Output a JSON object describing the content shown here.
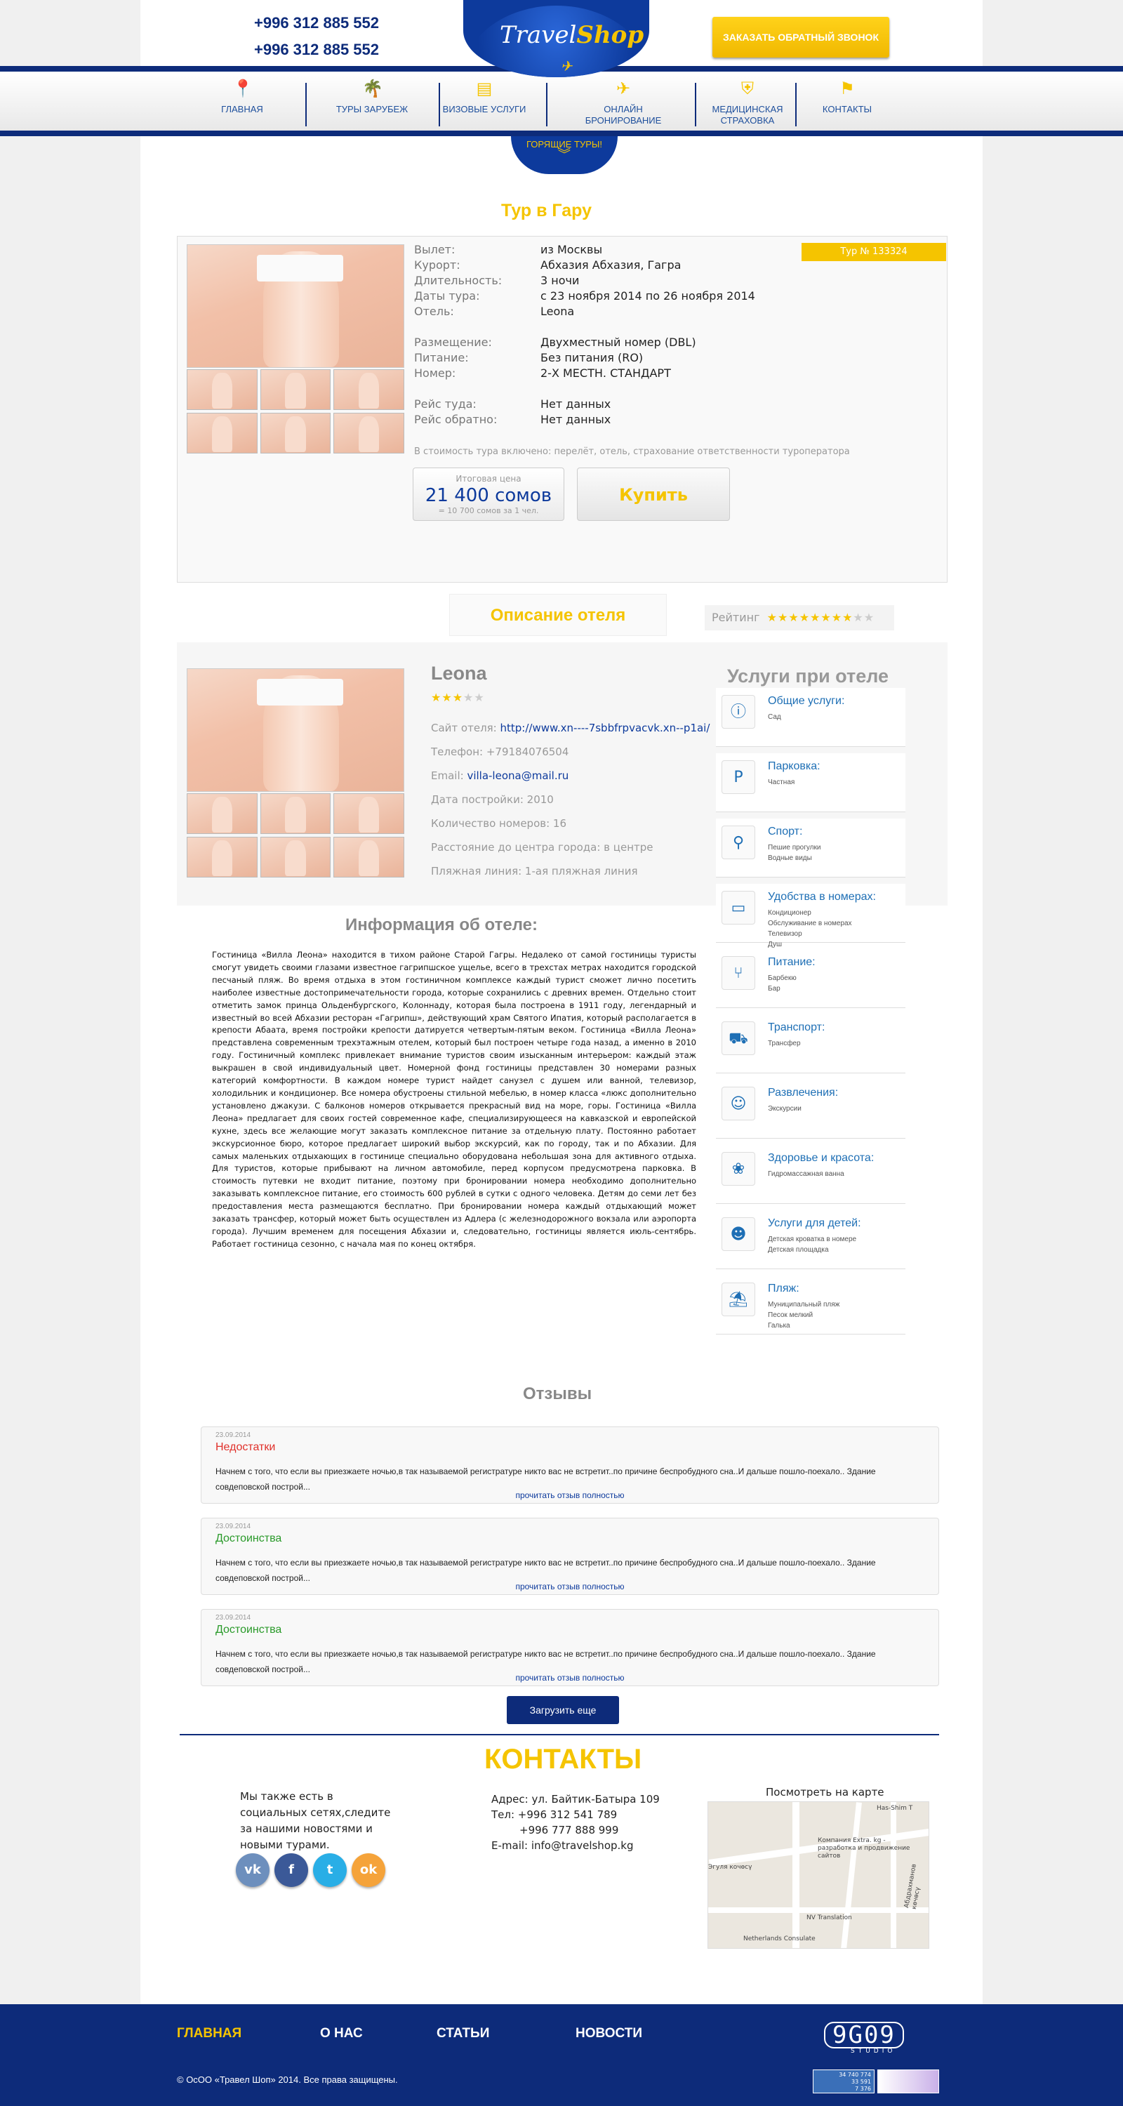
{
  "header": {
    "phone1": "+996 312 885 552",
    "phone2": "+996 312 885 552",
    "logo_travel": "Travel",
    "logo_shop": "Shop",
    "callback_label": "ЗАКАЗАТЬ ОБРАТНЫЙ ЗВОНОК",
    "hot_tours": "ГОРЯЩИЕ ТУРЫ!"
  },
  "nav": [
    {
      "label": "ГЛАВНАЯ",
      "icon": "location-pin-icon"
    },
    {
      "label": "ТУРЫ ЗАРУБЕЖ",
      "icon": "palm-tree-icon"
    },
    {
      "label": "ВИЗОВЫЕ УСЛУГИ",
      "icon": "passport-icon"
    },
    {
      "label": "ОНЛАЙН БРОНИРОВАНИЕ",
      "icon": "plane-icon"
    },
    {
      "label": "МЕДИЦИНСКАЯ СТРАХОВКА",
      "icon": "shield-icon"
    },
    {
      "label": "КОНТАКТЫ",
      "icon": "signpost-icon"
    }
  ],
  "tour": {
    "title": "Тур в Гару",
    "number": "Тур № 133324",
    "rows": [
      {
        "label": "Вылет:",
        "value": "из Москвы"
      },
      {
        "label": "Курорт:",
        "value": "Абхазия Абхазия, Гагра"
      },
      {
        "label": "Длительность:",
        "value": "3 ночи"
      },
      {
        "label": "Даты тура:",
        "value": "с 23 ноября 2014 по 26 ноября 2014"
      },
      {
        "label": "Отель:",
        "value": "Leona"
      },
      {
        "label": "Размещение:",
        "value": "Двухместный номер (DBL)"
      },
      {
        "label": "Питание:",
        "value": "Без питания (RO)"
      },
      {
        "label": "Номер:",
        "value": "2-Х МЕСТН. СТАНДАРТ"
      },
      {
        "label": "Рейс туда:",
        "value": "Нет данных"
      },
      {
        "label": "Рейс обратно:",
        "value": "Нет данных"
      }
    ],
    "included": "В стоимость тура включено: перелёт, отель, страхование ответственности туроператора",
    "price_label": "Итоговая цена",
    "price": "21 400 сомов",
    "price_per": "= 10 700 сомов за 1 чел.",
    "buy_label": "Купить"
  },
  "hotel": {
    "tab_label": "Описание отеля",
    "rating_label": "Рейтинг",
    "rating_value": 8,
    "rating_max": 10,
    "name": "Leona",
    "stars": 3,
    "site_label": "Сайт отеля:",
    "site": "http://www.xn----7sbbfrpvacvk.xn--p1ai/",
    "phone": "Телефон: +79184076504",
    "email_label": "Email:",
    "email": "villa-leona@mail.ru",
    "built": "Дата постройки: 2010",
    "rooms": "Количество номеров: 16",
    "distance": "Расстояние до центра города: в центре",
    "beach_line": "Пляжная линия: 1-ая пляжная линия"
  },
  "services": {
    "title": "Услуги при отеле",
    "items": [
      {
        "title": "Общие услуги:",
        "details": [
          "Сад"
        ],
        "icon": "info-icon"
      },
      {
        "title": "Парковка:",
        "details": [
          "Частная"
        ],
        "icon": "parking-icon"
      },
      {
        "title": "Спорт:",
        "details": [
          "Пешие прогулки",
          "Водные виды"
        ],
        "icon": "bicycle-icon"
      },
      {
        "title": "Удобства в номерах:",
        "details": [
          "Кондиционер",
          "Обслуживание в номерах",
          "Телевизор",
          "Душ"
        ],
        "icon": "tv-icon"
      },
      {
        "title": "Питание:",
        "details": [
          "Барбекю",
          "Бар"
        ],
        "icon": "cutlery-icon"
      },
      {
        "title": "Транспорт:",
        "details": [
          "Трансфер"
        ],
        "icon": "car-icon"
      },
      {
        "title": "Развлечения:",
        "details": [
          "Экскурсии"
        ],
        "icon": "dancing-icon"
      },
      {
        "title": "Здоровье и красота:",
        "details": [
          "Гидромассажная ванна"
        ],
        "icon": "spa-icon"
      },
      {
        "title": "Услуги для детей:",
        "details": [
          "Детская кроватка в номере",
          "Детская площадка"
        ],
        "icon": "child-icon"
      },
      {
        "title": "Пляж:",
        "details": [
          "Муниципальный пляж",
          "Песок мелкий",
          "Галька"
        ],
        "icon": "beach-icon"
      }
    ]
  },
  "info": {
    "title": "Информация об отеле:",
    "text": "Гостиница «Вилла Леона» находится в тихом районе Старой Гагры. Недалеко от самой гостиницы туристы смогут увидеть своими глазами известное гагрипшское ущелье, всего в трехстах метрах находится городской песчаный пляж. Во время отдыха в этом гостиничном комплексе каждый турист сможет лично посетить наиболее известные достопримечательности города, которые сохранились с древних времен. Отдельно стоит отметить замок принца Ольденбургского, Колоннаду, которая была построена в 1911 году, легендарный и известный во всей Абхазии ресторан «Гагрипш», действующий храм Святого Ипатия, который располагается в крепости Абаата, время постройки крепости датируется четвертым-пятым веком. Гостиница «Вилла Леона» представлена современным трехэтажным отелем, который был построен четыре года назад, а именно в 2010 году. Гостиничный комплекс привлекает внимание туристов своим изысканным интерьером: каждый этаж выкрашен в свой индивидуальный цвет. Номерной фонд гостиницы представлен 30 номерами разных категорий комфортности. В каждом номере турист найдет санузел с душем или ванной, телевизор, холодильник и кондиционер. Все номера обустроены стильной мебелью, в номер класса «люкс дополнительно установлено джакузи. С балконов номеров открывается прекрасный вид на море, горы. Гостиница «Вилла Леона» предлагает для своих гостей современное кафе, специализирующееся на кавказской и европейской кухне, здесь все желающие могут заказать комплексное питание за отдельную плату. Постоянно работает экскурсионное бюро, которое предлагает широкий выбор экскурсий, как по городу, так и по Абхазии. Для самых маленьких отдыхающих в гостинице специально оборудована небольшая зона для активного отдыха. Для туристов, которые прибывают на личном автомобиле, перед корпусом предусмотрена парковка. В стоимость путевки не входит питание, поэтому при бронировании номера необходимо дополнительно заказывать комплексное питание, его стоимость 600 рублей в сутки с одного человека. Детям до семи лет без предоставления места размещаются бесплатно. При бронировании номера каждый отдыхающий может заказать трансфер, который может быть осуществлен из Адлера (с железнодорожного вокзала или аэропорта города). Лучшим временем для посещения Абхазии и, следовательно, гостиницы является июль-сентябрь. Работает гостиница сезонно, с начала мая по конец октября."
  },
  "reviews": {
    "title": "Отзывы",
    "items": [
      {
        "date": "23.09.2014",
        "kind": "Недостатки",
        "kind_color": "#e0302a",
        "text": "Начнем с того, что если вы приезжаете ночью,в так называемой регистратуре никто вас не встретит..по причине беспробудного сна..И дальше пошло-поехало.. Здание совдеповской построй...",
        "more": "прочитать отзыв полностью"
      },
      {
        "date": "23.09.2014",
        "kind": "Достоинства",
        "kind_color": "#2a9a2a",
        "text": "Начнем с того, что если вы приезжаете ночью,в так называемой регистратуре никто вас не встретит..по причине беспробудного сна..И дальше пошло-поехало.. Здание совдеповской построй...",
        "more": "прочитать отзыв полностью"
      },
      {
        "date": "23.09.2014",
        "kind": "Достоинства",
        "kind_color": "#2a9a2a",
        "text": "Начнем с того, что если вы приезжаете ночью,в так называемой регистратуре никто вас не встретит..по причине беспробудного сна..И дальше пошло-поехало.. Здание совдеповской построй...",
        "more": "прочитать отзыв полностью"
      }
    ],
    "load_more": "Загрузить еще"
  },
  "contacts": {
    "title": "КОНТАКТЫ",
    "social_text": "Мы также есть в социальных сетях,следите за нашими новостями и новыми турами.",
    "social": [
      {
        "label": "vk",
        "icon": "vk-icon",
        "color": "#6d8fbd"
      },
      {
        "label": "f",
        "icon": "facebook-icon",
        "color": "#3b5998"
      },
      {
        "label": "t",
        "icon": "twitter-icon",
        "color": "#29aee6"
      },
      {
        "label": "ok",
        "icon": "odnoklassniki-icon",
        "color": "#f5a33a"
      }
    ],
    "address": "Адрес: ул. Байтик-Батыра 109",
    "tel1": "Тел:  +996 312 541 789",
    "tel2": "+996 777 888 999",
    "email": "E-mail: info@travelshop.kg",
    "map_title": "Посмотреть на карте",
    "map_labels": [
      "Has-Shim T",
      "Компания Extra. kg - разработка и продвижение сайтов",
      "Эгуля кочөсү",
      "NV Translation",
      "Netherlands Consulate",
      "Абдрахманов көчөсү"
    ]
  },
  "footer": {
    "nav": [
      "ГЛАВНАЯ",
      "О НАС",
      "СТАТЬИ",
      "НОВОСТИ"
    ],
    "active_color": "#f5c400",
    "studio": "9G09",
    "studio_sub": "STUDIO",
    "copyright": "© ОсОО «Травел Шоп» 2014. Все права защищены.",
    "counter": [
      "34 740 774",
      "33 591",
      "7 376"
    ]
  }
}
